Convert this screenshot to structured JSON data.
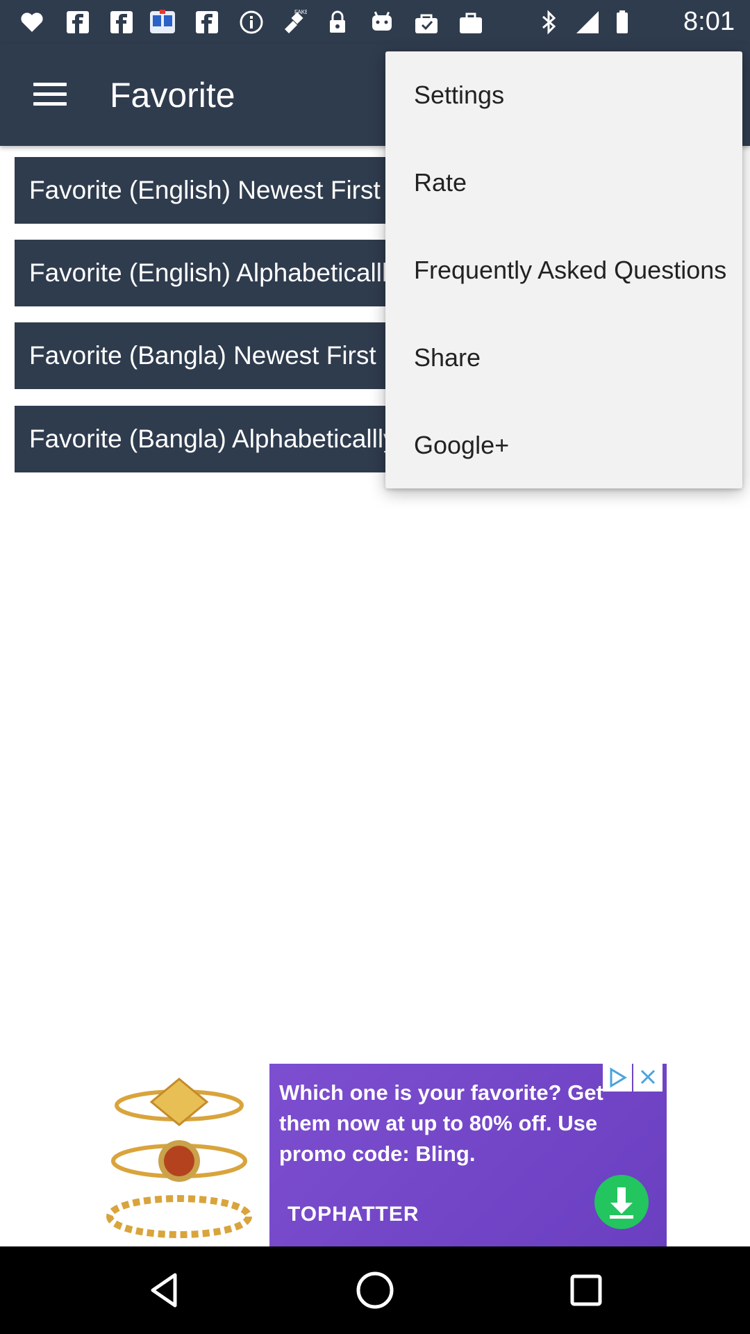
{
  "status_bar": {
    "time": "8:01",
    "left_icons": [
      "iheart-icon",
      "facebook-icon",
      "facebook-icon",
      "dictionary-app-icon",
      "facebook-icon",
      "info-icon",
      "fake-gps-icon",
      "lock-icon",
      "android-icon",
      "check-bag-icon",
      "briefcase-icon"
    ],
    "right_icons": [
      "bluetooth-icon",
      "signal-icon",
      "battery-icon"
    ]
  },
  "app_bar": {
    "title": "Favorite",
    "menu_icon": "hamburger-icon"
  },
  "list": [
    {
      "label": "Favorite (English) Newest First"
    },
    {
      "label": "Favorite (English) Alphabeticallly"
    },
    {
      "label": "Favorite (Bangla) Newest First"
    },
    {
      "label": "Favorite (Bangla) Alphabeticallly"
    }
  ],
  "menu": {
    "items": [
      {
        "label": "Settings"
      },
      {
        "label": "Rate"
      },
      {
        "label": "Frequently Asked Questions"
      },
      {
        "label": "Share"
      },
      {
        "label": "Google+"
      }
    ]
  },
  "ad": {
    "text": "Which one is your favorite? Get them now at up to 80% off. Use promo code: Bling.",
    "brand": "TOPHATTER",
    "adchoices_icon": "adchoices-icon",
    "close_icon": "close-icon",
    "download_icon": "download-icon"
  },
  "nav_bar": {
    "back_icon": "back-icon",
    "home_icon": "home-icon",
    "recents_icon": "recents-icon"
  },
  "colors": {
    "primary": "#2f3c4e",
    "menu_bg": "#f2f2f2",
    "ad_purple": "#7d4ed0",
    "ad_green": "#22c55e"
  }
}
